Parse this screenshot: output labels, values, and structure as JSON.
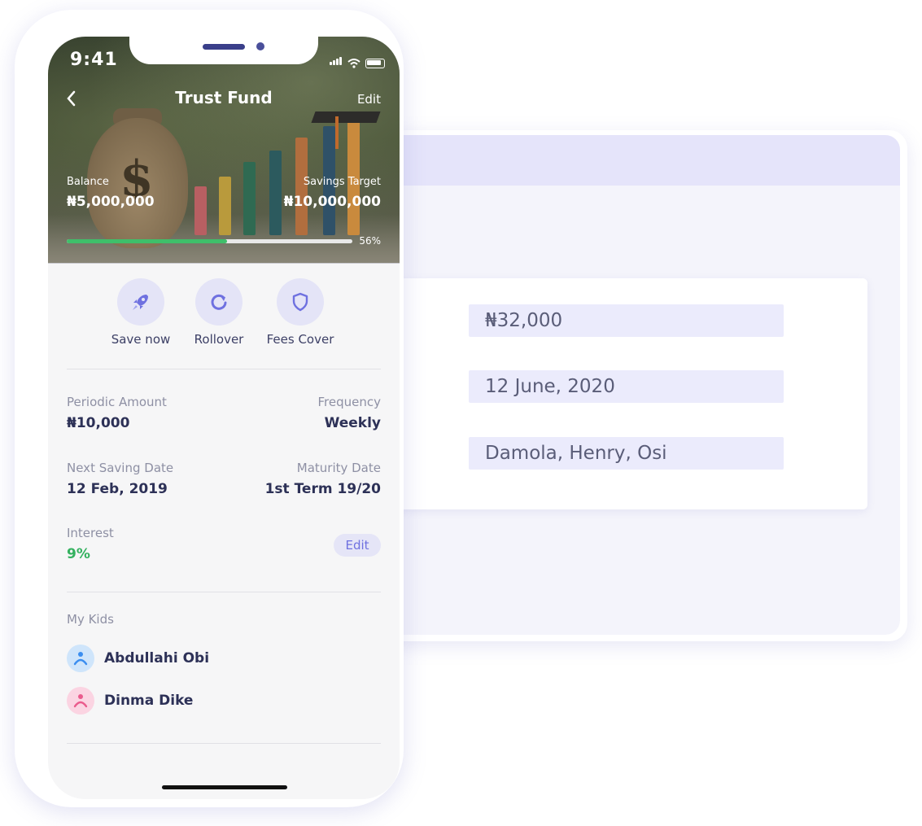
{
  "background_card": {
    "fields": [
      "₦32,000",
      "12 June, 2020",
      "Damola, Henry, Osi"
    ]
  },
  "status_bar": {
    "time": "9:41"
  },
  "header": {
    "title": "Trust Fund",
    "back_icon": "chevron-left-icon",
    "edit_label": "Edit"
  },
  "summary": {
    "balance_label": "Balance",
    "balance_value": "₦5,000,000",
    "target_label": "Savings Target",
    "target_value": "₦10,000,000",
    "progress_percent": 56,
    "progress_text": "56%",
    "progress_color": "#3fbf6a"
  },
  "actions": [
    {
      "label": "Save now",
      "icon": "rocket-icon"
    },
    {
      "label": "Rollover",
      "icon": "rollover-icon"
    },
    {
      "label": "Fees Cover",
      "icon": "shield-icon"
    }
  ],
  "details": {
    "periodic_amount_label": "Periodic Amount",
    "periodic_amount_value": "₦10,000",
    "frequency_label": "Frequency",
    "frequency_value": "Weekly",
    "next_saving_label": "Next Saving Date",
    "next_saving_value": "12 Feb, 2019",
    "maturity_label": "Maturity Date",
    "maturity_value": "1st Term 19/20",
    "interest_label": "Interest",
    "interest_value": "9%",
    "interest_color": "#34b15f",
    "edit_label": "Edit"
  },
  "kids": {
    "label": "My Kids",
    "items": [
      {
        "name": "Abdullahi Obi",
        "avatar_bg": "#cfe5fb",
        "avatar_fg": "#3b8ef0"
      },
      {
        "name": "Dinma Dike",
        "avatar_bg": "#fbd4e2",
        "avatar_fg": "#ea5b8d"
      }
    ]
  },
  "colors": {
    "accent": "#6f71e0",
    "text_dark": "#2d3157",
    "text_muted": "#8e90a4",
    "action_bg": "#e4e4f7"
  }
}
